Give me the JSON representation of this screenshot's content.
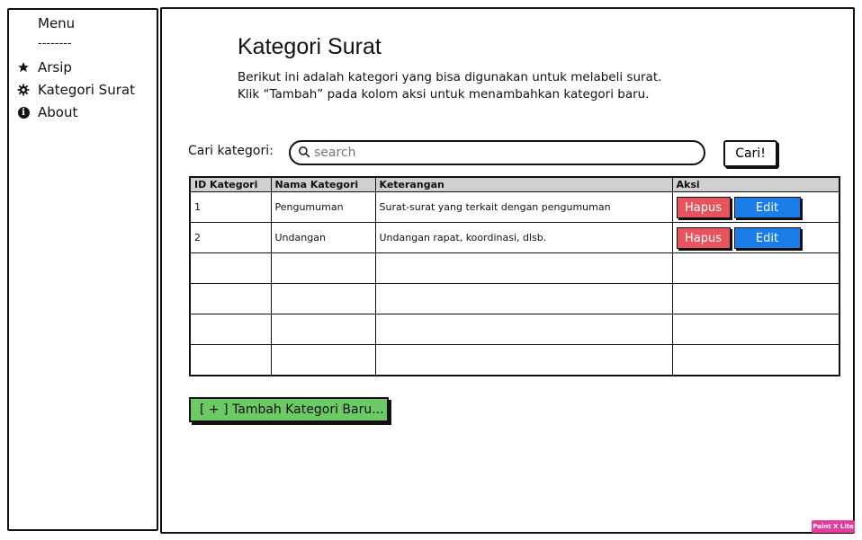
{
  "sidebar": {
    "title": "Menu",
    "separator": "--------",
    "items": [
      {
        "label": "Arsip",
        "icon": "star-icon"
      },
      {
        "label": "Kategori Surat",
        "icon": "gear-icon"
      },
      {
        "label": "About",
        "icon": "info-icon"
      }
    ]
  },
  "main": {
    "title": "Kategori Surat",
    "description_line1": "Berikut ini adalah kategori yang bisa digunakan untuk melabeli surat.",
    "description_line2": "Klik “Tambah” pada kolom aksi untuk menambahkan kategori baru.",
    "search": {
      "label": "Cari kategori:",
      "placeholder": "search",
      "value": "",
      "button_label": "Cari!"
    },
    "table": {
      "headers": [
        "ID Kategori",
        "Nama Kategori",
        "Keterangan",
        "Aksi"
      ],
      "rows": [
        {
          "id": "1",
          "name": "Pengumuman",
          "desc": "Surat-surat yang terkait dengan pengumuman"
        },
        {
          "id": "2",
          "name": "Undangan",
          "desc": "Undangan rapat, koordinasi, dlsb."
        }
      ],
      "delete_label": "Hapus",
      "edit_label": "Edit"
    },
    "add_button_label": "[ + ] Tambah Kategori Baru..."
  },
  "watermark": "Paint X Lite",
  "colors": {
    "delete_button": "#e8545e",
    "edit_button": "#1a7de8",
    "add_button": "#6cc965",
    "table_header": "#d0d0d0"
  }
}
